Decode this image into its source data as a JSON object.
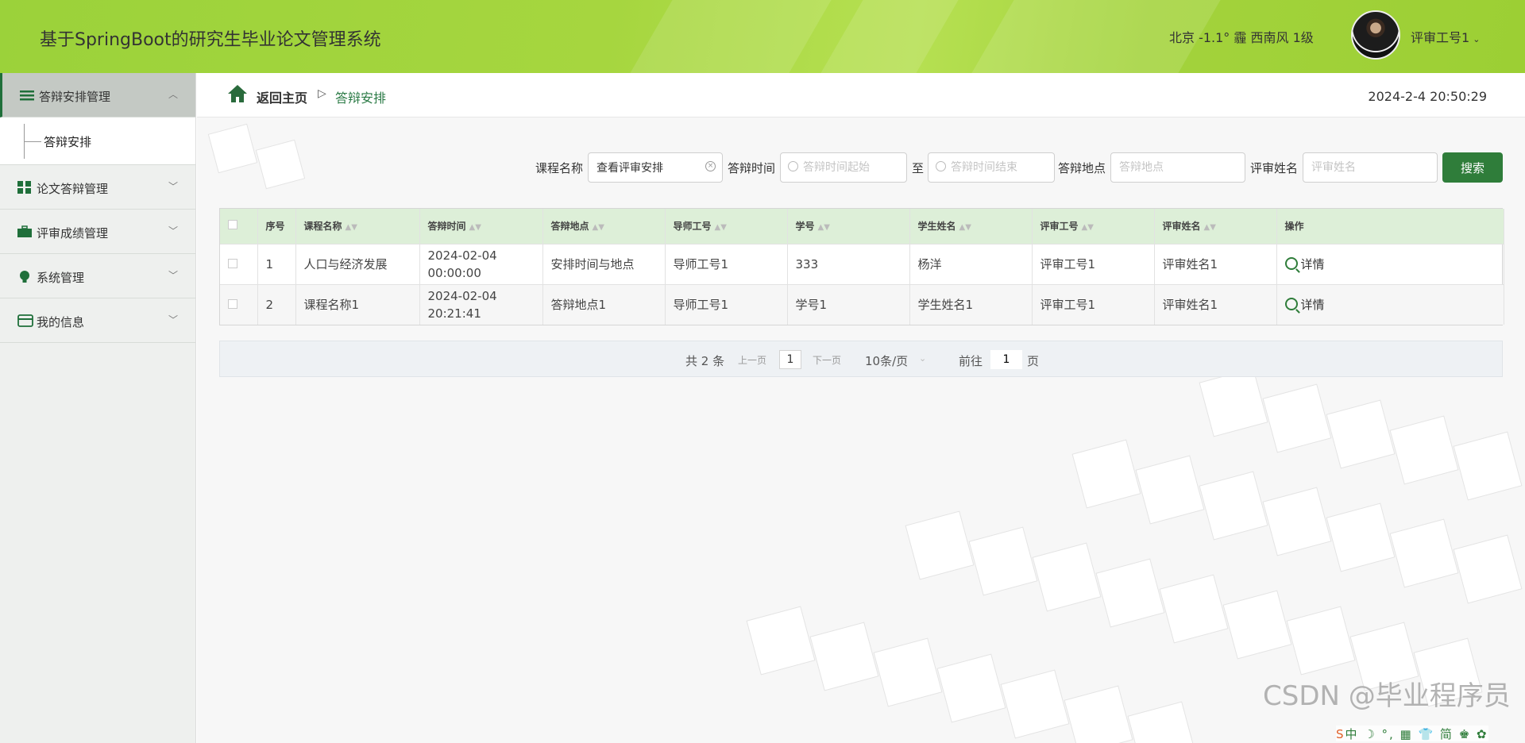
{
  "app": {
    "title": "基于SpringBoot的研究生毕业论文管理系统",
    "weather": "北京  -1.1°  霾  西南风  1级",
    "user": "评审工号1"
  },
  "sidebar": {
    "items": [
      {
        "label": "答辩安排管理",
        "icon": "list-icon",
        "expanded": true,
        "children": [
          "答辩安排"
        ]
      },
      {
        "label": "论文答辩管理",
        "icon": "grid-icon",
        "expanded": false
      },
      {
        "label": "评审成绩管理",
        "icon": "briefcase-icon",
        "expanded": false
      },
      {
        "label": "系统管理",
        "icon": "bulb-icon",
        "expanded": false
      },
      {
        "label": "我的信息",
        "icon": "card-icon",
        "expanded": false
      }
    ]
  },
  "breadcrumb": {
    "home": "返回主页",
    "separator": "▷",
    "current": "答辩安排"
  },
  "datetime": "2024-2-4 20:50:29",
  "search": {
    "course_label": "课程名称",
    "course_value": "查看评审安排",
    "time_label": "答辩时间",
    "time_start_placeholder": "答辩时间起始",
    "to_label": "至",
    "time_end_placeholder": "答辩时间结束",
    "place_label": "答辩地点",
    "place_placeholder": "答辩地点",
    "reviewer_label": "评审姓名",
    "reviewer_placeholder": "评审姓名",
    "button": "搜索"
  },
  "table": {
    "columns": [
      "序号",
      "课程名称",
      "答辩时间",
      "答辩地点",
      "导师工号",
      "学号",
      "学生姓名",
      "评审工号",
      "评审姓名",
      "操作"
    ],
    "rows": [
      {
        "no": "1",
        "course": "人口与经济发展",
        "time": "2024-02-04 00:00:00",
        "place": "安排时间与地点",
        "teacher_id": "导师工号1",
        "student_id": "333",
        "student_name": "杨洋",
        "reviewer_id": "评审工号1",
        "reviewer_name": "评审姓名1",
        "action": "详情"
      },
      {
        "no": "2",
        "course": "课程名称1",
        "time": "2024-02-04 20:21:41",
        "place": "答辩地点1",
        "teacher_id": "导师工号1",
        "student_id": "学号1",
        "student_name": "学生姓名1",
        "reviewer_id": "评审工号1",
        "reviewer_name": "评审姓名1",
        "action": "详情"
      }
    ]
  },
  "pagination": {
    "total": "共 2 条",
    "prev": "上一页",
    "current_page": "1",
    "next": "下一页",
    "page_size": "10条/页",
    "goto_label": "前往",
    "goto_value": "1",
    "page_suffix": "页"
  },
  "watermark": "CSDN @毕业程序员",
  "colors": {
    "header": "#a6d63f",
    "accent": "#2f7d3a",
    "table_header": "#ddefd8"
  }
}
